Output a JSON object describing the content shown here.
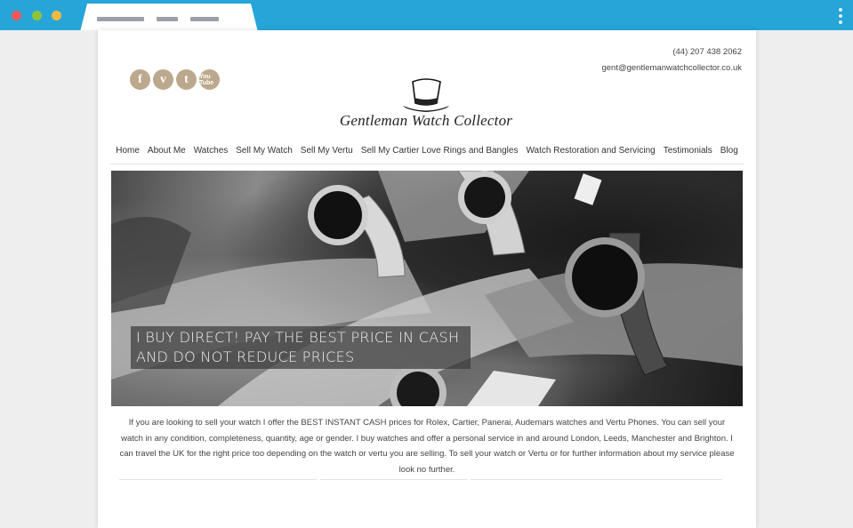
{
  "browser": {
    "dot_colors": [
      "#ee5a5a",
      "#8fc33a",
      "#f5b940"
    ],
    "accent": "#26a5d8"
  },
  "header": {
    "phone": "(44) 207 438 2062",
    "email": "gent@gentlemanwatchcollector.co.uk",
    "logo_text": "Gentleman Watch Collector",
    "logo_icon": "top-hat-icon"
  },
  "social": [
    {
      "name": "facebook-icon",
      "glyph": "f"
    },
    {
      "name": "vimeo-icon",
      "glyph": "v"
    },
    {
      "name": "twitter-icon",
      "glyph": "t"
    },
    {
      "name": "youtube-icon",
      "glyph": "You Tube"
    }
  ],
  "social_color": "#bca88c",
  "nav": [
    "Home",
    "About Me",
    "Watches",
    "Sell My Watch",
    "Sell My Vertu",
    "Sell My Cartier Love Rings and Bangles",
    "Watch Restoration and Servicing",
    "Testimonials",
    "Blog"
  ],
  "hero": {
    "caption_line1": "I BUY DIRECT! PAY THE BEST PRICE IN CASH",
    "caption_line2": "AND DO NOT REDUCE PRICES"
  },
  "intro": {
    "text": "If you are looking to sell your watch I offer the BEST INSTANT CASH prices for Rolex, Cartier, Panerai, Audemars watches and Vertu Phones. You can sell your watch in any condition, completeness, quantity, age or gender. I buy watches and offer a personal service in and around London, Leeds, Manchester and Brighton. I can travel the UK for the right price too depending on the watch or vertu you are selling. To sell your watch or Vertu or for further information about my service please look no further."
  }
}
